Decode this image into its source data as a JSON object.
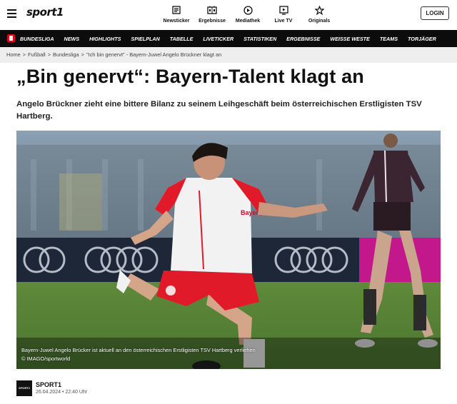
{
  "header": {
    "logo": "sport1",
    "login_label": "LOGIN",
    "nav": [
      {
        "label": "Newsticker",
        "icon": "newsticker-icon"
      },
      {
        "label": "Ergebnisse",
        "icon": "scoreboard-icon"
      },
      {
        "label": "Mediathek",
        "icon": "play-icon"
      },
      {
        "label": "Live TV",
        "icon": "tv-icon"
      },
      {
        "label": "Originals",
        "icon": "star-icon"
      }
    ]
  },
  "main_nav": [
    "BUNDESLIGA",
    "NEWS",
    "HIGHLIGHTS",
    "SPIELPLAN",
    "TABELLE",
    "LIVETICKER",
    "STATISTIKEN",
    "ERGEBNISSE",
    "WEISSE WESTE",
    "TEAMS",
    "TORJÄGER"
  ],
  "breadcrumb": [
    "Home",
    "Fußball",
    "Bundesliga",
    "\"Ich bin genervt\" - Bayern-Juwel Angelo Brückner klagt an"
  ],
  "article": {
    "title": "„Bin genervt“: Bayern-Talent klagt an",
    "lead": "Angelo Brückner zieht eine bittere Bilanz zu seinem Leihgeschäft beim österreichischen Erstligisten TSV Hartberg.",
    "image_caption": "Bayern-Juwel Angelo Brücker ist aktuell an den österreichischen Erstligisten TSV Hartberg verliehen",
    "image_credit": "© IMAGO/sportworld",
    "shirt_sponsor": "Bayern Munich"
  },
  "author": {
    "badge": "SPORT1",
    "name": "SPORT1",
    "date": "26.04.2024 • 22:40 Uhr"
  },
  "colors": {
    "accent": "#e2001a",
    "nav_bg": "#0c0c0c",
    "breadcrumb_bg": "#eeeeee"
  }
}
